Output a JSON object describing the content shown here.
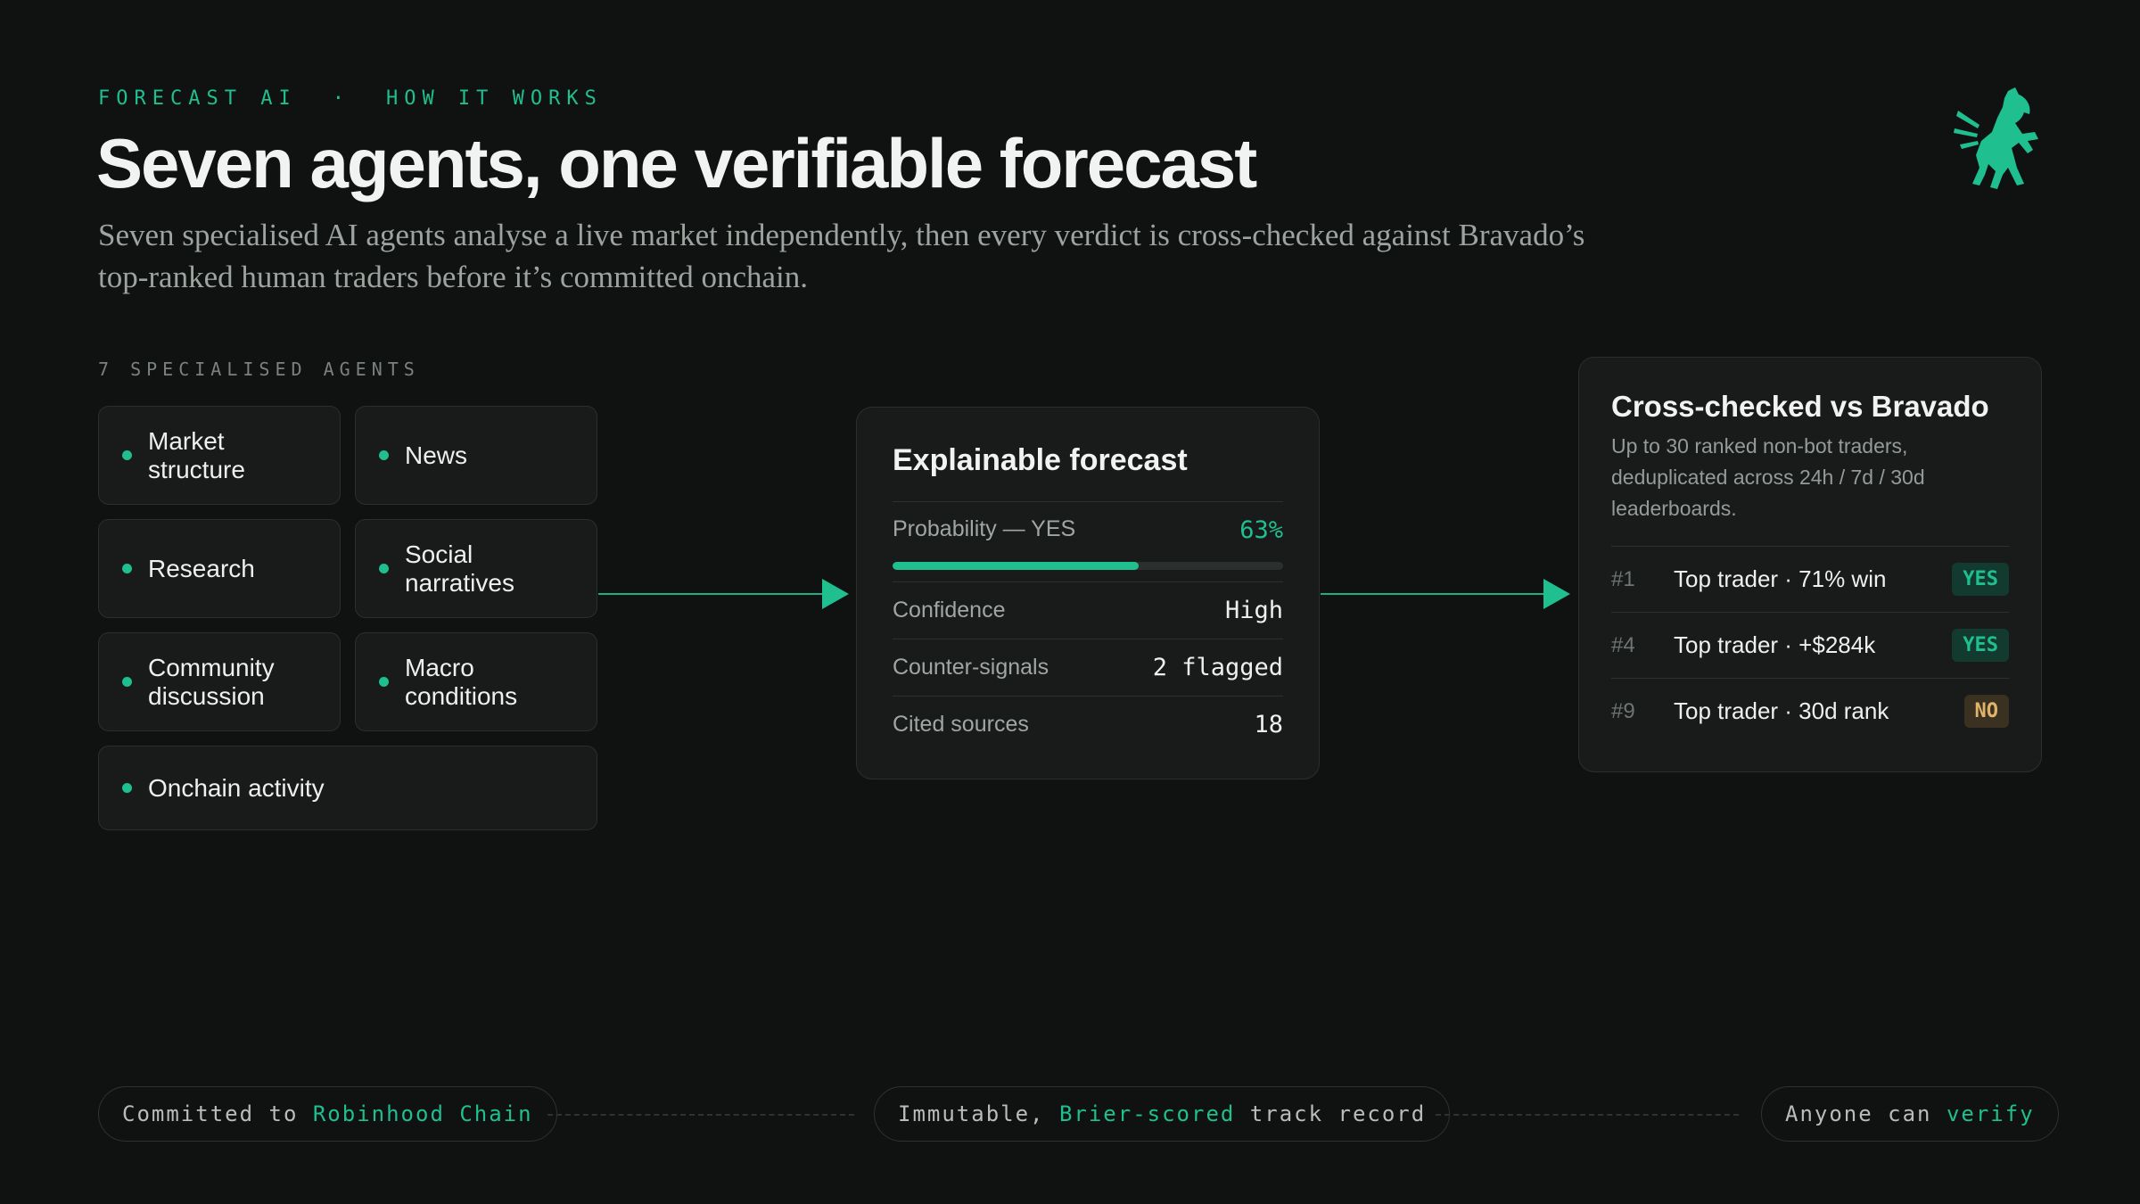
{
  "header": {
    "eyebrow_left": "FORECAST AI",
    "eyebrow_sep": "·",
    "eyebrow_right": "HOW IT WORKS",
    "title": "Seven agents, one verifiable forecast",
    "subtitle": "Seven specialised AI agents analyse a live market independently, then every verdict is cross-checked against Bravado’s top-ranked human traders before it’s committed onchain.",
    "logo_icon": "rearing-horse-icon"
  },
  "agents": {
    "section_label": "7 SPECIALISED AGENTS",
    "items": [
      {
        "label": "Market structure"
      },
      {
        "label": "News"
      },
      {
        "label": "Research"
      },
      {
        "label": "Social narratives"
      },
      {
        "label": "Community discussion"
      },
      {
        "label": "Macro conditions"
      },
      {
        "label": "Onchain activity"
      }
    ]
  },
  "forecast": {
    "title": "Explainable forecast",
    "probability_label": "Probability — YES",
    "probability_value": "63%",
    "probability_fraction": 0.63,
    "rows": [
      {
        "key": "Confidence",
        "value": "High"
      },
      {
        "key": "Counter-signals",
        "value": "2 flagged"
      },
      {
        "key": "Cited sources",
        "value": "18"
      }
    ]
  },
  "crosscheck": {
    "title": "Cross-checked vs Bravado",
    "description": "Up to 30 ranked non-bot traders, deduplicated across 24h / 7d / 30d leaderboards.",
    "traders": [
      {
        "rank": "#1",
        "name": "Top trader · 71% win",
        "verdict": "YES"
      },
      {
        "rank": "#4",
        "name": "Top trader · +$284k",
        "verdict": "YES"
      },
      {
        "rank": "#9",
        "name": "Top trader · 30d rank",
        "verdict": "NO"
      }
    ]
  },
  "footer": {
    "pill1": {
      "pre": "Committed to ",
      "hl": "Robinhood Chain",
      "post": ""
    },
    "pill2": {
      "pre": "Immutable, ",
      "hl": "Brier-scored",
      "post": " track record"
    },
    "pill3": {
      "pre": "Anyone can ",
      "hl": "verify",
      "post": ""
    }
  },
  "colors": {
    "accent": "#1fbf8f",
    "background": "#101211",
    "card": "#181b1a",
    "no_badge": "#e0b46a"
  }
}
